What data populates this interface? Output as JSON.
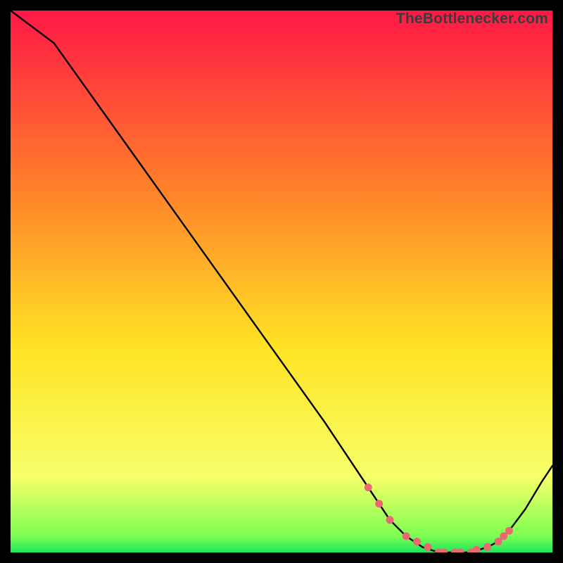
{
  "watermark": "TheBottlenecker.com",
  "colors": {
    "frame": "#000000",
    "grad_top": "#ff1846",
    "grad_mid1": "#ff7e2b",
    "grad_mid2": "#ffe324",
    "grad_low": "#f7ff6a",
    "grad_green": "#1de65a",
    "line": "#000000",
    "dot": "#e86a6f"
  },
  "chart_data": {
    "type": "line",
    "title": "",
    "xlabel": "",
    "ylabel": "",
    "xlim": [
      0,
      100
    ],
    "ylim": [
      0,
      100
    ],
    "series": [
      {
        "name": "bottleneck-curve",
        "x": [
          0,
          8,
          18,
          28,
          38,
          48,
          58,
          66,
          70,
          73,
          76,
          79,
          82,
          85,
          88,
          90,
          92,
          95,
          98,
          100
        ],
        "y": [
          100,
          94,
          80,
          66,
          52,
          38,
          24,
          12,
          6,
          3,
          1,
          0,
          0,
          0,
          1,
          2,
          4,
          8,
          13,
          16
        ]
      }
    ],
    "markers": {
      "name": "highlight-dots",
      "x": [
        66,
        68,
        70,
        73,
        75,
        77,
        79,
        80,
        82,
        83,
        85,
        86,
        88,
        90,
        91,
        92
      ],
      "y": [
        12,
        9,
        6,
        3,
        2,
        1,
        0,
        0,
        0,
        0,
        0,
        0.5,
        1,
        2,
        3,
        4
      ]
    }
  }
}
